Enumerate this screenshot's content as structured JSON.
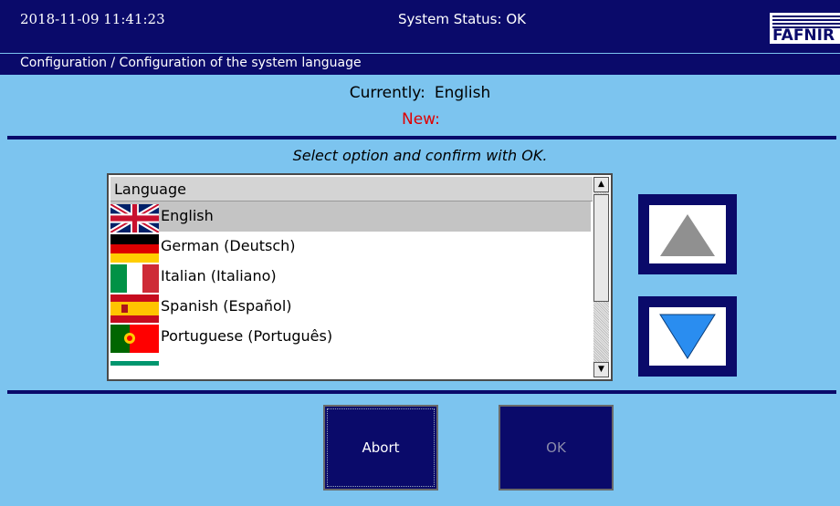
{
  "header": {
    "datetime": "2018-11-09  11:41:23",
    "status": "System Status: OK",
    "logo_text": "FAFNIR"
  },
  "breadcrumb": "Configuration / Configuration of the system language",
  "language": {
    "current_label": "Currently:",
    "current_value": "English",
    "new_label": "New:"
  },
  "hint": "Select option and confirm with OK.",
  "list": {
    "header": "Language",
    "items": [
      {
        "label": "English",
        "flag": "uk-flag-icon",
        "selected": true
      },
      {
        "label": "German (Deutsch)",
        "flag": "germany-flag-icon",
        "selected": false
      },
      {
        "label": "Italian (Italiano)",
        "flag": "italy-flag-icon",
        "selected": false
      },
      {
        "label": "Spanish (Español)",
        "flag": "spain-flag-icon",
        "selected": false
      },
      {
        "label": "Portuguese (Português)",
        "flag": "portugal-flag-icon",
        "selected": false
      }
    ]
  },
  "buttons": {
    "abort": "Abort",
    "ok": "OK"
  },
  "colors": {
    "background": "#7cc4ef",
    "dark_blue": "#0a0a6a",
    "new_label": "#e00000",
    "arrow_up": "#909090",
    "arrow_down": "#2a8df0"
  }
}
